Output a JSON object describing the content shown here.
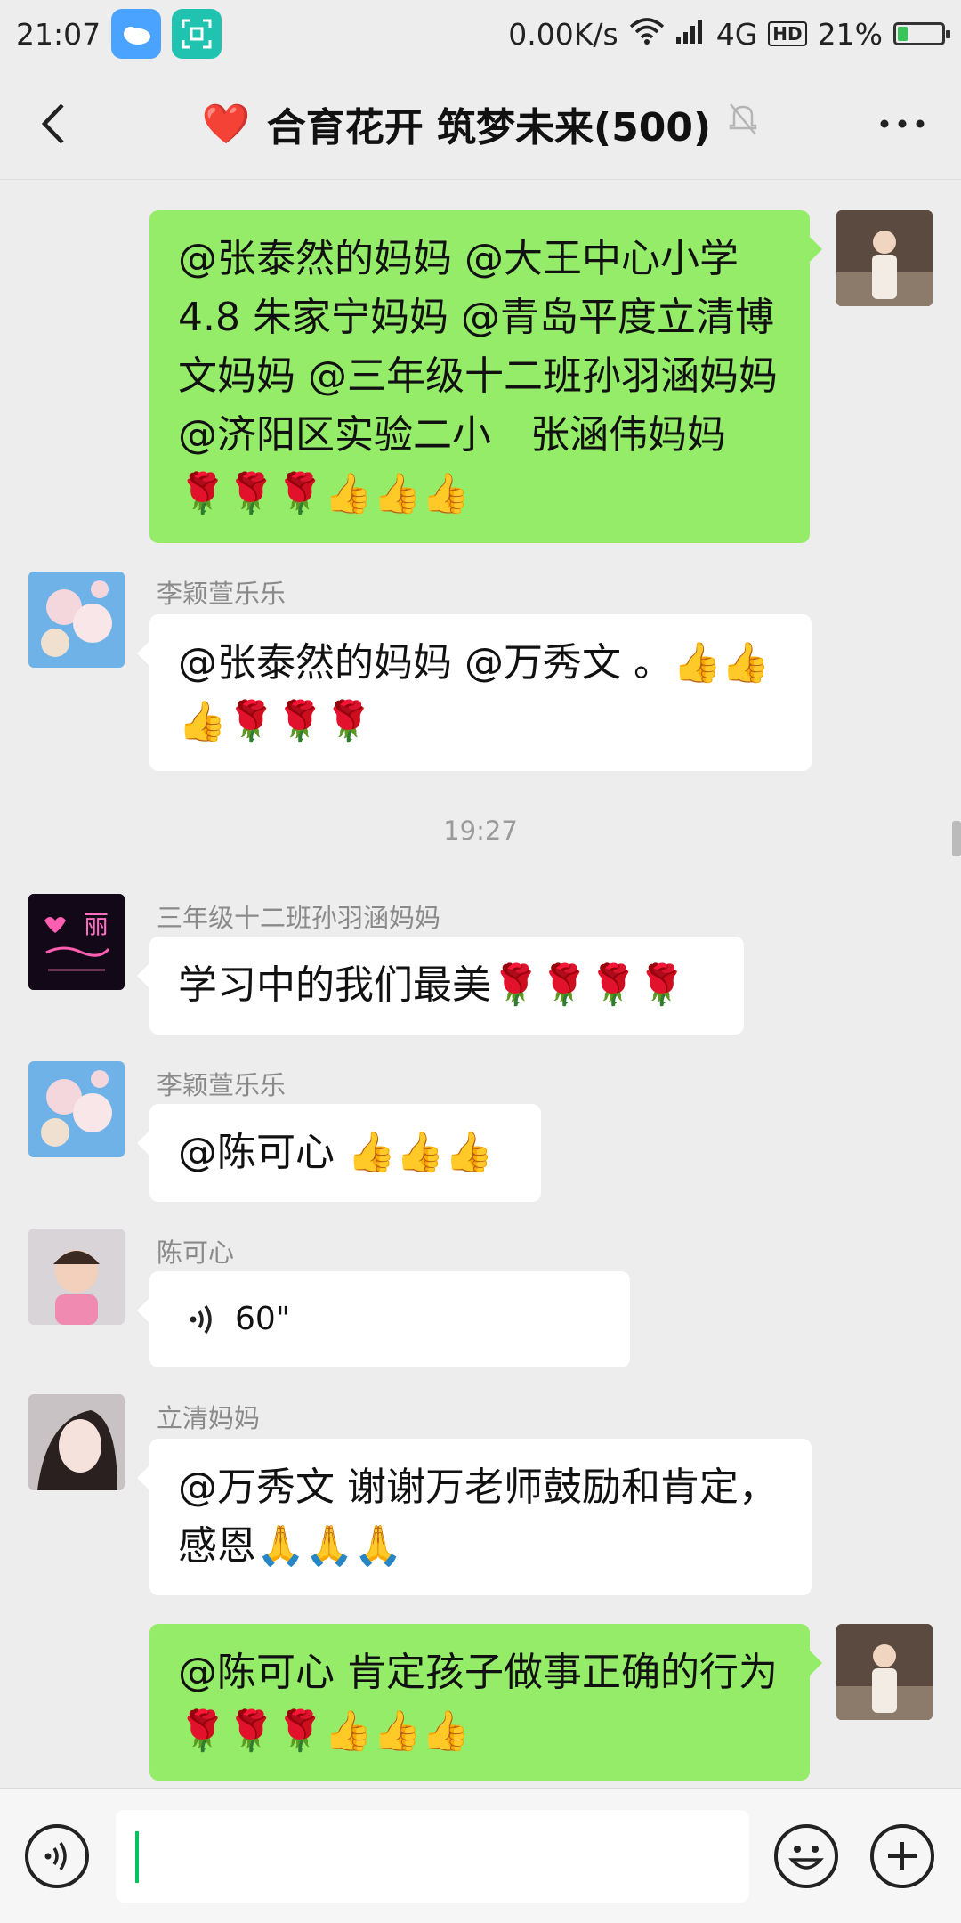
{
  "status_bar": {
    "time": "21:07",
    "network_speed": "0.00K/s",
    "network_type": "4G",
    "hd_label": "HD",
    "battery_percent": "21%",
    "battery_level": 0.21
  },
  "nav": {
    "title_emoji": "❤️",
    "title": "合育花开 筑梦未来(500)"
  },
  "messages": [
    {
      "id": "m1",
      "direction": "out",
      "text": "@张泰然的妈妈 @大王中心小学4.8 朱家宁妈妈 @青岛平度立清博文妈妈 @三年级十二班孙羽涵妈妈 @济阳区实验二小　张涵伟妈妈 🌹🌹🌹👍👍👍"
    },
    {
      "id": "m2",
      "direction": "in",
      "sender": "李颖萱乐乐",
      "text": "@张泰然的妈妈 @万秀文 。👍👍👍🌹🌹🌹"
    },
    {
      "id": "m3",
      "direction": "in",
      "sender": "三年级十二班孙羽涵妈妈",
      "text": "学习中的我们最美🌹🌹🌹🌹",
      "avatar_text": "丽"
    },
    {
      "id": "m4",
      "direction": "in",
      "sender": "李颖萱乐乐",
      "text": "@陈可心 👍👍👍"
    },
    {
      "id": "m5",
      "direction": "in",
      "sender": "陈可心",
      "voice_duration": "60\""
    },
    {
      "id": "m6",
      "direction": "in",
      "sender": "立清妈妈",
      "text": "@万秀文 谢谢万老师鼓励和肯定，感恩🙏🙏🙏"
    },
    {
      "id": "m7",
      "direction": "out",
      "text": "@陈可心 肯定孩子做事正确的行为🌹🌹🌹👍👍👍"
    }
  ],
  "timestamp": "19:27",
  "colors": {
    "background": "#ededed",
    "outgoing_bubble": "#95ec69",
    "incoming_bubble": "#ffffff",
    "accent": "#07c160"
  }
}
